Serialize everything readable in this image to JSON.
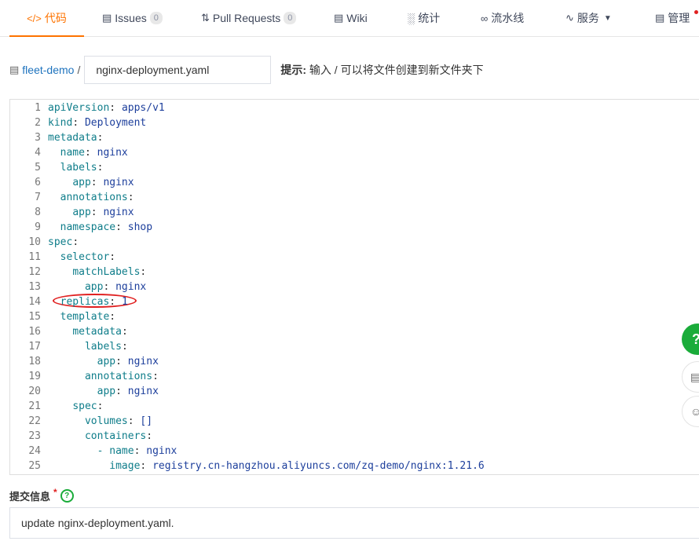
{
  "nav": {
    "code": "代码",
    "issues": "Issues",
    "issues_count": "0",
    "pull_requests": "Pull Requests",
    "pull_requests_count": "0",
    "wiki": "Wiki",
    "stats": "统计",
    "pipeline": "流水线",
    "services": "服务",
    "manage": "管理"
  },
  "path": {
    "repo": "fleet-demo",
    "separator": "/",
    "filename": "nginx-deployment.yaml",
    "hint_label": "提示:",
    "hint_text": "输入 / 可以将文件创建到新文件夹下"
  },
  "editor": {
    "lines": [
      {
        "n": "1",
        "indent": "",
        "key": "apiVersion",
        "sep": ": ",
        "val": "apps/v1"
      },
      {
        "n": "2",
        "indent": "",
        "key": "kind",
        "sep": ": ",
        "val": "Deployment"
      },
      {
        "n": "3",
        "indent": "",
        "key": "metadata",
        "sep": ":",
        "val": ""
      },
      {
        "n": "4",
        "indent": "  ",
        "key": "name",
        "sep": ": ",
        "val": "nginx"
      },
      {
        "n": "5",
        "indent": "  ",
        "key": "labels",
        "sep": ":",
        "val": ""
      },
      {
        "n": "6",
        "indent": "    ",
        "key": "app",
        "sep": ": ",
        "val": "nginx"
      },
      {
        "n": "7",
        "indent": "  ",
        "key": "annotations",
        "sep": ":",
        "val": ""
      },
      {
        "n": "8",
        "indent": "    ",
        "key": "app",
        "sep": ": ",
        "val": "nginx"
      },
      {
        "n": "9",
        "indent": "  ",
        "key": "namespace",
        "sep": ": ",
        "val": "shop"
      },
      {
        "n": "10",
        "indent": "",
        "key": "spec",
        "sep": ":",
        "val": ""
      },
      {
        "n": "11",
        "indent": "  ",
        "key": "selector",
        "sep": ":",
        "val": ""
      },
      {
        "n": "12",
        "indent": "    ",
        "key": "matchLabels",
        "sep": ":",
        "val": ""
      },
      {
        "n": "13",
        "indent": "      ",
        "key": "app",
        "sep": ": ",
        "val": "nginx"
      },
      {
        "n": "14",
        "indent": "  ",
        "key": "replicas",
        "sep": ": ",
        "val": "1"
      },
      {
        "n": "15",
        "indent": "  ",
        "key": "template",
        "sep": ":",
        "val": ""
      },
      {
        "n": "16",
        "indent": "    ",
        "key": "metadata",
        "sep": ":",
        "val": ""
      },
      {
        "n": "17",
        "indent": "      ",
        "key": "labels",
        "sep": ":",
        "val": ""
      },
      {
        "n": "18",
        "indent": "        ",
        "key": "app",
        "sep": ": ",
        "val": "nginx"
      },
      {
        "n": "19",
        "indent": "      ",
        "key": "annotations",
        "sep": ":",
        "val": ""
      },
      {
        "n": "20",
        "indent": "        ",
        "key": "app",
        "sep": ": ",
        "val": "nginx"
      },
      {
        "n": "21",
        "indent": "    ",
        "key": "spec",
        "sep": ":",
        "val": ""
      },
      {
        "n": "22",
        "indent": "      ",
        "key": "volumes",
        "sep": ": ",
        "val": "[]"
      },
      {
        "n": "23",
        "indent": "      ",
        "key": "containers",
        "sep": ":",
        "val": ""
      },
      {
        "n": "24",
        "indent": "        ",
        "key": "- name",
        "sep": ": ",
        "val": "nginx"
      },
      {
        "n": "25",
        "indent": "          ",
        "key": "image",
        "sep": ": ",
        "val": "registry.cn-hangzhou.aliyuncs.com/zq-demo/nginx:1.21.6"
      }
    ]
  },
  "commit": {
    "label": "提交信息",
    "required_mark": "*",
    "help_glyph": "?",
    "message": "update nginx-deployment.yaml."
  },
  "fabs": {
    "help_glyph": "?",
    "doc_glyph": "▤",
    "feedback_glyph": "☺"
  },
  "colors": {
    "accent": "#fe7300",
    "link": "#1e73be",
    "key": "#0f7d8a",
    "value": "#1d3f9c",
    "highlight_ring": "#e02020",
    "help_green": "#1aac3a"
  }
}
